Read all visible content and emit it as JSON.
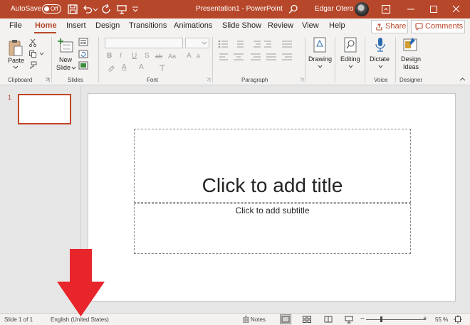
{
  "titlebar": {
    "autosave_label": "AutoSave",
    "autosave_state": "Off",
    "doc_title": "Presentation1  -  PowerPoint",
    "user_name": "Edgar Otero"
  },
  "menu": {
    "items": [
      "File",
      "Home",
      "Insert",
      "Design",
      "Transitions",
      "Animations",
      "Slide Show",
      "Review",
      "View",
      "Help"
    ],
    "active": "Home",
    "share_label": "Share",
    "comments_label": "Comments"
  },
  "ribbon": {
    "clipboard": {
      "paste_label": "Paste",
      "group_label": "Clipboard"
    },
    "slides": {
      "new_slide_line1": "New",
      "new_slide_line2": "Slide",
      "group_label": "Slides"
    },
    "font": {
      "group_label": "Font",
      "bold": "B",
      "italic": "I",
      "underline": "U",
      "strike": "S",
      "spacing": "ab",
      "case": "Aa",
      "grow": "A",
      "shrink": "A",
      "color_a": "A",
      "highlight_a": "A"
    },
    "paragraph": {
      "group_label": "Paragraph"
    },
    "drawing": {
      "label": "Drawing"
    },
    "editing": {
      "label": "Editing"
    },
    "voice": {
      "dictate_label": "Dictate",
      "group_label": "Voice"
    },
    "designer": {
      "design_line1": "Design",
      "design_line2": "Ideas",
      "group_label": "Designer"
    }
  },
  "slides_panel": {
    "slide_number": "1"
  },
  "slide": {
    "title_placeholder": "Click to add title",
    "subtitle_placeholder": "Click to add subtitle"
  },
  "statusbar": {
    "slide_info": "Slide 1 of 1",
    "language": "English (United States)",
    "notes_label": "Notes",
    "zoom_minus": "−",
    "zoom_plus": "+",
    "zoom_percent": "55 %"
  },
  "zoom_level": 0.55,
  "colors": {
    "accent": "#b7472a",
    "arrow": "#e8252a",
    "ribbon_bg": "#f3f2f1",
    "workspace": "#e6e6e6"
  }
}
